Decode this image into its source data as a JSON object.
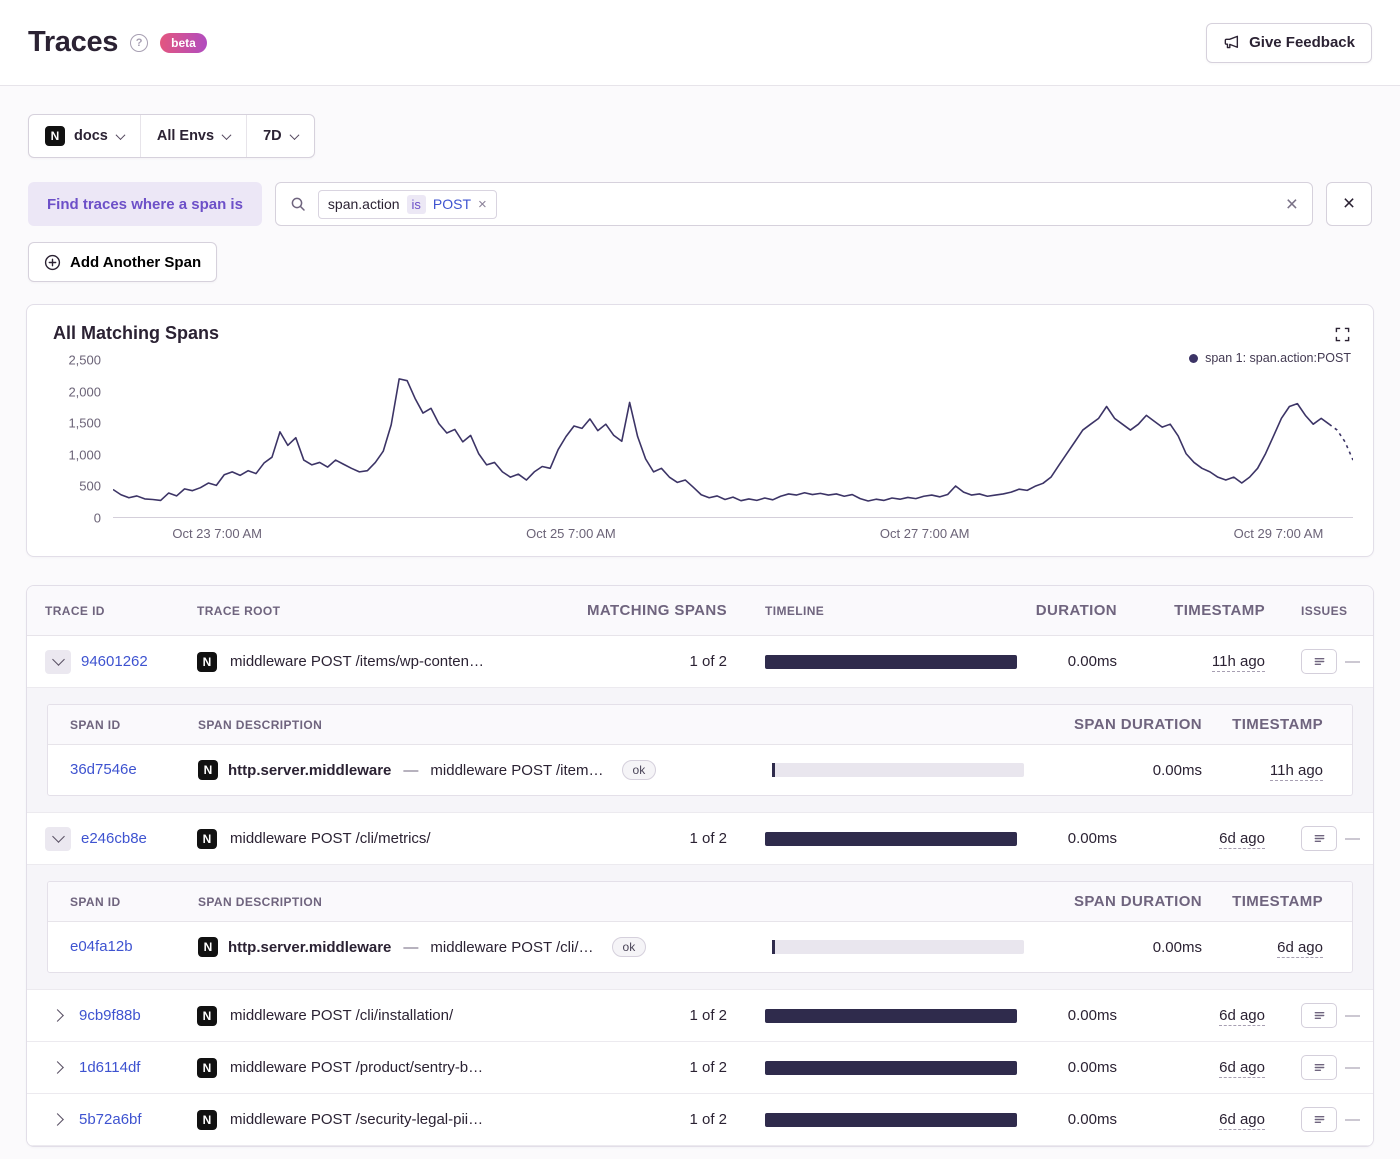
{
  "colors": {
    "accent_purple": "#6d50c8",
    "link_blue": "#3e53d0",
    "timeline_bar": "#2f2b4c",
    "chart_line": "#3c3466",
    "beta_gradient_start": "#e4567e",
    "beta_gradient_end": "#b04cc0"
  },
  "header": {
    "title": "Traces",
    "beta_badge": "beta",
    "help_glyph": "?",
    "feedback_button": "Give Feedback"
  },
  "filter_bar": {
    "project": {
      "icon": "nextjs",
      "logo_glyph": "N",
      "label": "docs"
    },
    "environment": "All Envs",
    "date_range": "7D"
  },
  "span_query": {
    "label": "Find traces where a span is",
    "token": {
      "key": "span.action",
      "operator": "is",
      "value": "POST",
      "remove_glyph": "×"
    },
    "clear_glyph": "×",
    "delete_glyph": "×",
    "add_button": "Add Another Span"
  },
  "chart_panel": {
    "title": "All Matching Spans",
    "legend": "span 1: span.action:POST"
  },
  "chart_data": {
    "type": "line",
    "title": "All Matching Spans",
    "legend_position": "top-right",
    "grid": false,
    "ylim": [
      0,
      2500
    ],
    "y_tick_labels": [
      "0",
      "500",
      "1,000",
      "1,500",
      "2,000",
      "2,500"
    ],
    "x_tick_labels": [
      "Oct 23 7:00 AM",
      "Oct 25 7:00 AM",
      "Oct 27 7:00 AM",
      "Oct 29 7:00 AM"
    ],
    "series": [
      {
        "name": "span 1: span.action:POST",
        "values": [
          400,
          310,
          260,
          290,
          240,
          230,
          215,
          340,
          290,
          410,
          380,
          430,
          510,
          470,
          650,
          700,
          640,
          720,
          670,
          850,
          950,
          1380,
          1150,
          1280,
          900,
          820,
          860,
          780,
          900,
          830,
          760,
          700,
          720,
          860,
          1050,
          1500,
          2280,
          2250,
          1950,
          1700,
          1780,
          1520,
          1360,
          1420,
          1210,
          1320,
          1010,
          820,
          860,
          700,
          610,
          660,
          560,
          700,
          790,
          760,
          1080,
          1300,
          1480,
          1440,
          1600,
          1400,
          1510,
          1320,
          1220,
          1880,
          1300,
          920,
          700,
          760,
          610,
          520,
          560,
          440,
          310,
          260,
          290,
          230,
          270,
          210,
          240,
          215,
          255,
          225,
          285,
          325,
          305,
          345,
          315,
          335,
          305,
          325,
          285,
          315,
          245,
          205,
          235,
          215,
          255,
          235,
          265,
          245,
          285,
          305,
          275,
          315,
          460,
          355,
          305,
          325,
          285,
          305,
          325,
          355,
          405,
          385,
          455,
          505,
          610,
          810,
          1010,
          1210,
          1410,
          1510,
          1610,
          1810,
          1610,
          1510,
          1410,
          1510,
          1660,
          1560,
          1460,
          1510,
          1310,
          1010,
          860,
          760,
          700,
          610,
          560,
          610,
          510,
          610,
          760,
          1010,
          1310,
          1610,
          1810,
          1860,
          1660,
          1510,
          1610,
          1510,
          1410,
          1210,
          900
        ]
      }
    ]
  },
  "table": {
    "columns": [
      "TRACE ID",
      "TRACE ROOT",
      "MATCHING SPANS",
      "TIMELINE",
      "DURATION",
      "TIMESTAMP",
      "ISSUES"
    ],
    "span_columns": [
      "SPAN ID",
      "SPAN DESCRIPTION",
      "SPAN DURATION",
      "TIMESTAMP"
    ],
    "desc_separator": "—",
    "rows": [
      {
        "id": "94601262",
        "root": "middleware POST /items/wp-conten…",
        "matching": "1 of 2",
        "duration": "0.00ms",
        "timestamp": "11h ago",
        "issues": "—",
        "spans": [
          {
            "id": "36d7546e",
            "op": "http.server.middleware",
            "desc": "middleware POST /item…",
            "status": "ok",
            "duration": "0.00ms",
            "timestamp": "11h ago"
          }
        ]
      },
      {
        "id": "e246cb8e",
        "root": "middleware POST /cli/metrics/",
        "matching": "1 of 2",
        "duration": "0.00ms",
        "timestamp": "6d ago",
        "issues": "—",
        "spans": [
          {
            "id": "e04fa12b",
            "op": "http.server.middleware",
            "desc": "middleware POST /cli/…",
            "status": "ok",
            "duration": "0.00ms",
            "timestamp": "6d ago"
          }
        ]
      },
      {
        "id": "9cb9f88b",
        "root": "middleware POST /cli/installation/",
        "matching": "1 of 2",
        "duration": "0.00ms",
        "timestamp": "6d ago",
        "issues": "—"
      },
      {
        "id": "1d6114df",
        "root": "middleware POST /product/sentry-b…",
        "matching": "1 of 2",
        "duration": "0.00ms",
        "timestamp": "6d ago",
        "issues": "—"
      },
      {
        "id": "5b72a6bf",
        "root": "middleware POST /security-legal-pii…",
        "matching": "1 of 2",
        "duration": "0.00ms",
        "timestamp": "6d ago",
        "issues": "—"
      }
    ]
  }
}
